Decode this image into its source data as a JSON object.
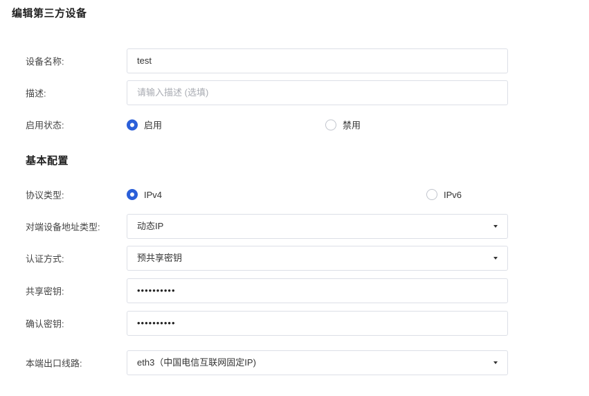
{
  "page_title": "编辑第三方设备",
  "device_name": {
    "label": "设备名称:",
    "value": "test"
  },
  "description": {
    "label": "描述:",
    "placeholder": "请输入描述 (选填)"
  },
  "enable_status": {
    "label": "启用状态:",
    "options": [
      {
        "label": "启用",
        "checked": true
      },
      {
        "label": "禁用",
        "checked": false
      }
    ]
  },
  "basic_config": {
    "title": "基本配置"
  },
  "protocol_type": {
    "label": "协议类型:",
    "options": [
      {
        "label": "IPv4",
        "checked": true
      },
      {
        "label": "IPv6",
        "checked": false
      }
    ]
  },
  "peer_address_type": {
    "label": "对端设备地址类型:",
    "value": "动态IP"
  },
  "auth_method": {
    "label": "认证方式:",
    "value": "预共享密钥"
  },
  "shared_key": {
    "label": "共享密钥:",
    "value": "••••••••••"
  },
  "confirm_key": {
    "label": "确认密钥:",
    "value": "••••••••••"
  },
  "local_outlet": {
    "label": "本端出口线路:",
    "value": "eth3（中国电信互联网固定IP)"
  },
  "colors": {
    "accent": "#2b5fd9",
    "border": "#dcdfe6",
    "placeholder": "#a8abb2"
  }
}
